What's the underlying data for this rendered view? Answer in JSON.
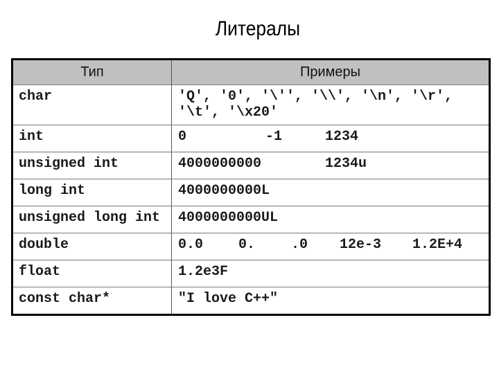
{
  "slide": {
    "title": "Литералы"
  },
  "table": {
    "headers": {
      "type": "Тип",
      "examples": "Примеры"
    },
    "rows": [
      {
        "type": "char",
        "examples": [
          "'Q', '0', '\\'', '\\\\', '\\n', '\\r',",
          "'\\t', '\\x20'"
        ]
      },
      {
        "type": "int",
        "examples": [
          "0",
          "-1",
          "1234"
        ]
      },
      {
        "type": "unsigned int",
        "examples": [
          "4000000000",
          "1234u"
        ]
      },
      {
        "type": "long int",
        "examples": [
          "4000000000L"
        ]
      },
      {
        "type": "unsigned long int",
        "examples": [
          "4000000000UL"
        ]
      },
      {
        "type": "double",
        "examples": [
          "0.0",
          "0.",
          ".0",
          "12e-3",
          "1.2E+4"
        ]
      },
      {
        "type": "float",
        "examples": [
          "1.2e3F"
        ]
      },
      {
        "type": "const char*",
        "examples": [
          "\"I love C++\""
        ]
      }
    ]
  },
  "colors": {
    "header_background": "#c0c0c0",
    "border": "#000000",
    "text": "#000000"
  }
}
